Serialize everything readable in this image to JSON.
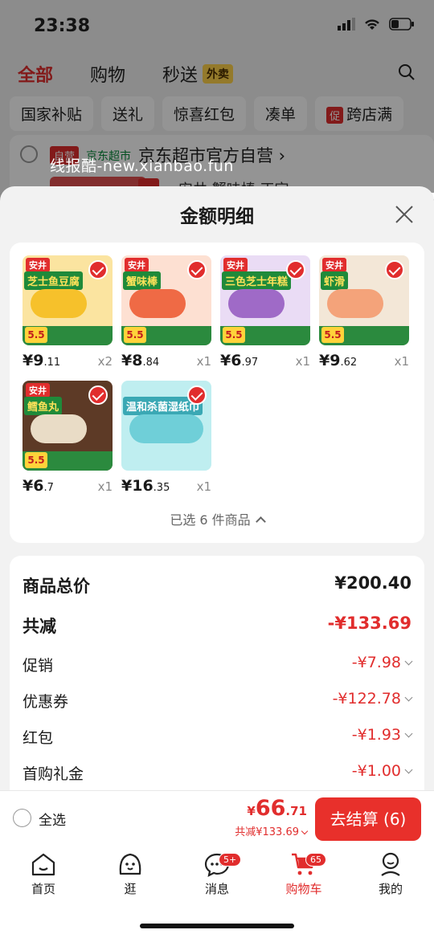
{
  "status": {
    "time": "23:38"
  },
  "topTabs": [
    {
      "label": "全部"
    },
    {
      "label": "购物"
    },
    {
      "label": "秒送"
    }
  ],
  "topTabBadge": "外卖",
  "filters": [
    "国家补贴",
    "送礼",
    "惊喜红包",
    "凑单",
    "跨店满"
  ],
  "filterBadge": "促",
  "store": {
    "tag": "自营",
    "sub": "京东超市",
    "name": "京东超市官方自营 ›",
    "itemText": "安井 蟹味棒 正宗 ..."
  },
  "watermark": "线报酷-new.xianbao.fun",
  "sheet": {
    "title": "金额明细",
    "items": [
      {
        "label": "芝士鱼豆腐",
        "price_int": "¥9",
        "price_dec": ".11",
        "qty": "x2",
        "promo": "5.5",
        "color": "#f6c12b"
      },
      {
        "label": "蟹味棒",
        "price_int": "¥8",
        "price_dec": ".84",
        "qty": "x1",
        "promo": "5.5",
        "color": "#ef6a45"
      },
      {
        "label": "三色芝士年糕",
        "price_int": "¥6",
        "price_dec": ".97",
        "qty": "x1",
        "promo": "5.5",
        "color": "#9f6ac7"
      },
      {
        "label": "虾滑",
        "price_int": "¥9",
        "price_dec": ".62",
        "qty": "x1",
        "promo": "5.5",
        "color": "#f4a37a"
      },
      {
        "label": "鳕鱼丸",
        "price_int": "¥6",
        "price_dec": ".7",
        "qty": "x1",
        "promo": "5.5",
        "color": "#e9dcc6"
      },
      {
        "label": "温和杀菌湿纸巾",
        "price_int": "¥16",
        "price_dec": ".35",
        "qty": "x1",
        "promo": "",
        "color": "#6fcfd8"
      }
    ],
    "selectedSummary": "已选 6 件商品",
    "summary": [
      {
        "label": "商品总价",
        "value": "¥200.40"
      },
      {
        "label": "共减",
        "value": "-¥133.69"
      },
      {
        "label": "促销",
        "value": "-¥7.98"
      },
      {
        "label": "优惠券",
        "value": "-¥122.78"
      },
      {
        "label": "红包",
        "value": "-¥1.93"
      },
      {
        "label": "首购礼金",
        "value": "-¥1.00"
      }
    ]
  },
  "checkout": {
    "selectAll": "全选",
    "currency": "¥",
    "total_int": "66",
    "total_dec": ".71",
    "saving": "共减¥133.69",
    "button": "去结算 (6)"
  },
  "tabbar": [
    {
      "label": "首页",
      "icon": "home-icon"
    },
    {
      "label": "逛",
      "icon": "stroll-icon"
    },
    {
      "label": "消息",
      "icon": "message-icon",
      "badge": "5+"
    },
    {
      "label": "购物车",
      "icon": "cart-icon",
      "badge": "65"
    },
    {
      "label": "我的",
      "icon": "profile-icon"
    }
  ],
  "colors": {
    "accent": "#e12d2d",
    "green": "#1f8a3a"
  }
}
